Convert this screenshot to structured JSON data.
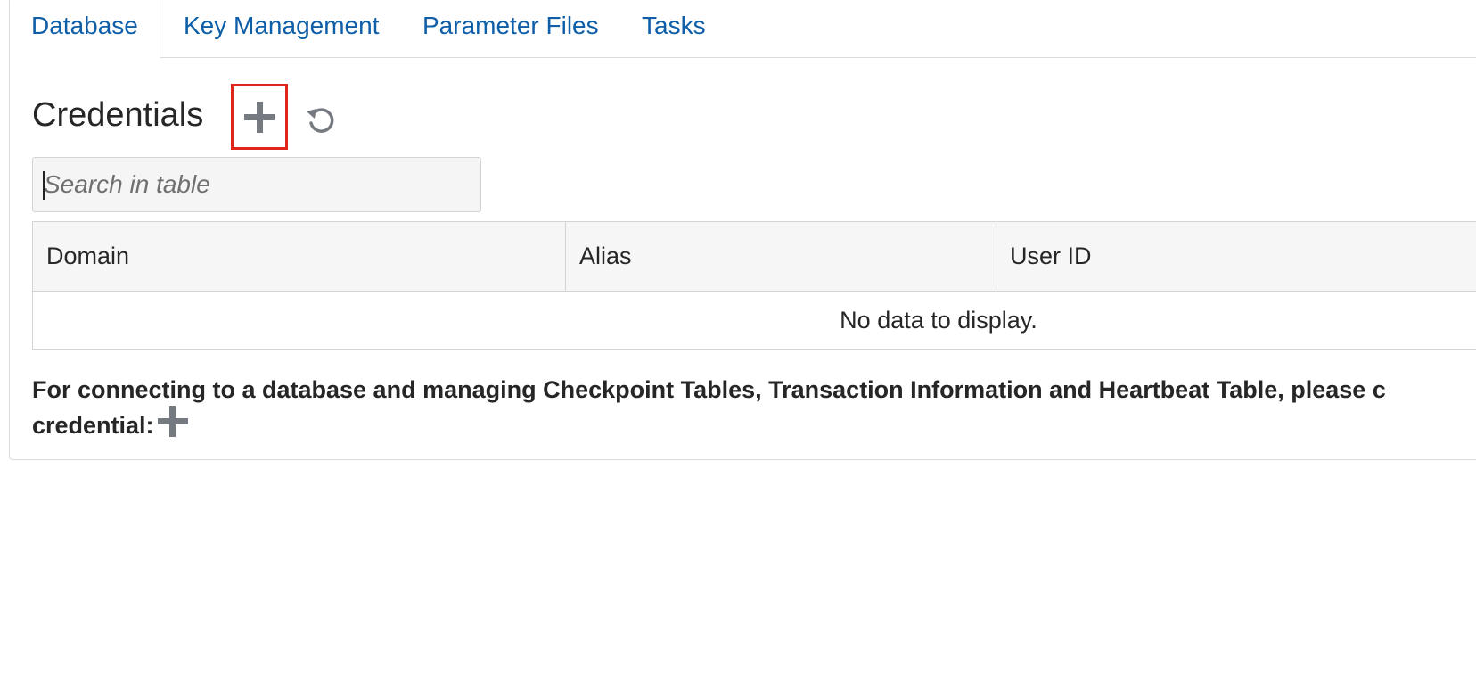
{
  "tabs": [
    {
      "label": "Database",
      "active": true
    },
    {
      "label": "Key Management",
      "active": false
    },
    {
      "label": "Parameter Files",
      "active": false
    },
    {
      "label": "Tasks",
      "active": false
    }
  ],
  "credentials": {
    "title": "Credentials",
    "add_icon": "plus-icon",
    "refresh_icon": "refresh-icon",
    "highlight_color": "#e0261b"
  },
  "search": {
    "placeholder": "Search in table",
    "value": ""
  },
  "table": {
    "columns": [
      "Domain",
      "Alias",
      "User ID"
    ],
    "rows": [],
    "empty_text": "No data to display."
  },
  "note": {
    "line1": "For connecting to a database and managing Checkpoint Tables, Transaction Information and Heartbeat Table, please c",
    "line2": "credential:"
  },
  "colors": {
    "link": "#0e5ea8",
    "icon": "#747a80",
    "border": "#dcdcdc"
  }
}
